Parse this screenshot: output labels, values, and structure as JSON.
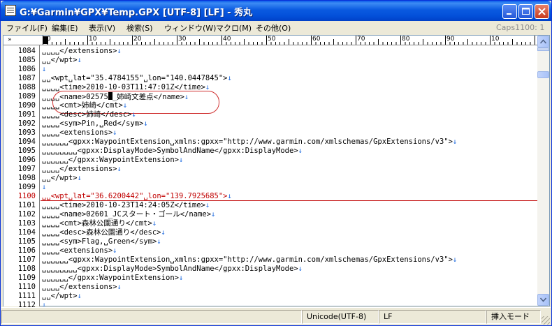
{
  "window": {
    "title": "G:¥Garmin¥GPX¥Temp.GPX [UTF-8] [LF] - 秀丸"
  },
  "menu": {
    "items": [
      "ファイル(F)",
      "編集(E)",
      "表示(V)",
      "検索(S)",
      "ウィンドウ(W)",
      "マクロ(M)",
      "その他(O)"
    ],
    "caps": "Caps",
    "position": "1100: 1"
  },
  "ruler": {
    "lead": "»",
    "labels": [
      "0",
      "10",
      "20",
      "30",
      "40",
      "50",
      "60",
      "70",
      "80",
      "90",
      "10"
    ]
  },
  "editor": {
    "current_line": "1100",
    "lines": [
      {
        "num": "1084",
        "text": "␣␣␣␣</extensions>",
        "eol": "↓"
      },
      {
        "num": "1085",
        "text": "␣␣</wpt>",
        "eol": "↓"
      },
      {
        "num": "1086",
        "text": "",
        "eol": "↓"
      },
      {
        "num": "1087",
        "text": "␣␣<wpt␣lat=\"35.4784155\"␣lon=\"140.0447845\">",
        "eol": "↓"
      },
      {
        "num": "1088",
        "text": "␣␣␣␣<time>2010-10-03T11:47:01Z</time>",
        "eol": "↓"
      },
      {
        "num": "1089",
        "text": "␣␣␣␣<name>02575",
        "cursor": true,
        "text2": "_姉崎文差点</name>",
        "eol": "↓"
      },
      {
        "num": "1090",
        "text": "␣␣␣␣<cmt>姉崎</cmt>",
        "eol": "↓"
      },
      {
        "num": "1091",
        "text": "␣␣␣␣<desc>姉崎</desc>",
        "eol": "↓"
      },
      {
        "num": "1092",
        "text": "␣␣␣␣<sym>Pin,␣Red</sym>",
        "eol": "↓"
      },
      {
        "num": "1093",
        "text": "␣␣␣␣<extensions>",
        "eol": "↓"
      },
      {
        "num": "1094",
        "text": "␣␣␣␣␣␣<gpxx:WaypointExtension␣xmlns:gpxx=\"http://www.garmin.com/xmlschemas/GpxExtensions/v3\">",
        "eol": "↓"
      },
      {
        "num": "1095",
        "text": "␣␣␣␣␣␣␣␣<gpxx:DisplayMode>SymbolAndName</gpxx:DisplayMode>",
        "eol": "↓"
      },
      {
        "num": "1096",
        "text": "␣␣␣␣␣␣</gpxx:WaypointExtension>",
        "eol": "↓"
      },
      {
        "num": "1097",
        "text": "␣␣␣␣</extensions>",
        "eol": "↓"
      },
      {
        "num": "1098",
        "text": "␣␣</wpt>",
        "eol": "↓"
      },
      {
        "num": "1099",
        "text": "",
        "eol": "↓"
      },
      {
        "num": "1100",
        "text": "␣␣<wpt␣lat=\"36.6200442\"␣lon=\"139.7925685\">",
        "eol": "↓"
      },
      {
        "num": "1101",
        "text": "␣␣␣␣<time>2010-10-23T14:24:05Z</time>",
        "eol": "↓"
      },
      {
        "num": "1102",
        "text": "␣␣␣␣<name>02601_JCスタート・ゴール</name>",
        "eol": "↓"
      },
      {
        "num": "1103",
        "text": "␣␣␣␣<cmt>森林公園通り</cmt>",
        "eol": "↓"
      },
      {
        "num": "1104",
        "text": "␣␣␣␣<desc>森林公園通り</desc>",
        "eol": "↓"
      },
      {
        "num": "1105",
        "text": "␣␣␣␣<sym>Flag,␣Green</sym>",
        "eol": "↓"
      },
      {
        "num": "1106",
        "text": "␣␣␣␣<extensions>",
        "eol": "↓"
      },
      {
        "num": "1107",
        "text": "␣␣␣␣␣␣<gpxx:WaypointExtension␣xmlns:gpxx=\"http://www.garmin.com/xmlschemas/GpxExtensions/v3\">",
        "eol": "↓"
      },
      {
        "num": "1108",
        "text": "␣␣␣␣␣␣␣␣<gpxx:DisplayMode>SymbolAndName</gpxx:DisplayMode>",
        "eol": "↓"
      },
      {
        "num": "1109",
        "text": "␣␣␣␣␣␣</gpxx:WaypointExtension>",
        "eol": "↓"
      },
      {
        "num": "1110",
        "text": "␣␣␣␣</extensions>",
        "eol": "↓"
      },
      {
        "num": "1111",
        "text": "␣␣</wpt>",
        "eol": "↓"
      },
      {
        "num": "1112",
        "text": "",
        "eol": "↓"
      }
    ]
  },
  "status": {
    "encoding": "Unicode(UTF-8)",
    "line_ending": "LF",
    "mode": "挿入モード"
  },
  "colors": {
    "title_bar": "#0a5ae0",
    "current_line": "#c00000",
    "eol_mark": "#1e6be0",
    "highlight_oval": "#d03030"
  }
}
